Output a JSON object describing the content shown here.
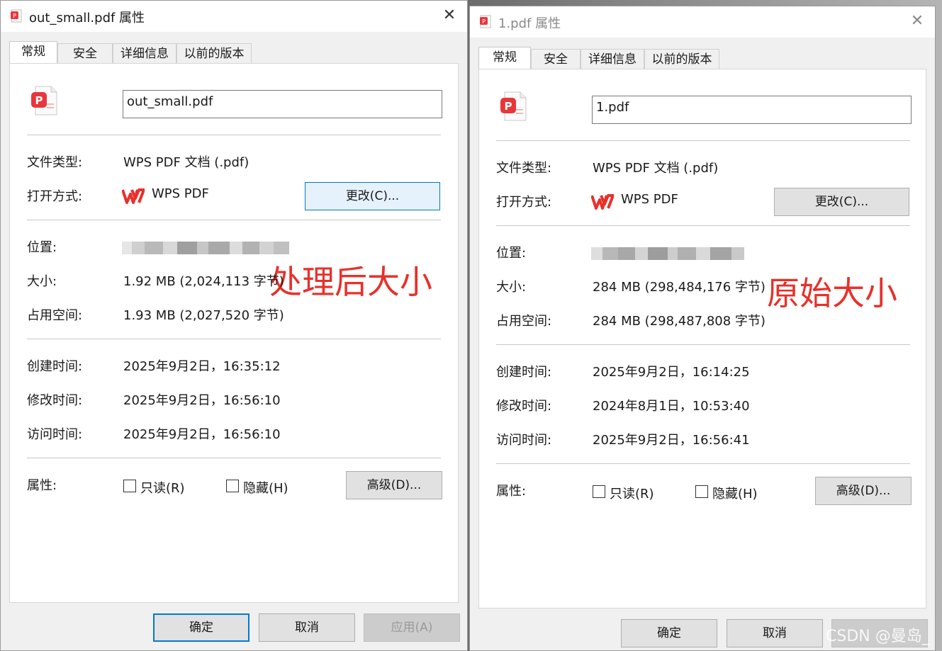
{
  "left": {
    "title": "out_small.pdf 属性",
    "tabs": [
      "常规",
      "安全",
      "详细信息",
      "以前的版本"
    ],
    "file_name": "out_small.pdf",
    "file_type_label": "文件类型:",
    "file_type": "WPS PDF 文档 (.pdf)",
    "open_with_label": "打开方式:",
    "open_with": "WPS PDF",
    "change_button": "更改(C)...",
    "location_label": "位置:",
    "size_label": "大小:",
    "size": "1.92 MB (2,024,113 字节)",
    "size_on_disk_label": "占用空间:",
    "size_on_disk": "1.93 MB (2,027,520 字节)",
    "created_label": "创建时间:",
    "created": "2025年9月2日，16:35:12",
    "modified_label": "修改时间:",
    "modified": "2025年9月2日，16:56:10",
    "accessed_label": "访问时间:",
    "accessed": "2025年9月2日，16:56:10",
    "attributes_label": "属性:",
    "readonly_label": "只读(R)",
    "hidden_label": "隐藏(H)",
    "advanced_button": "高级(D)...",
    "ok_button": "确定",
    "cancel_button": "取消",
    "apply_button": "应用(A)",
    "annotation": "处理后大小"
  },
  "right": {
    "title": "1.pdf 属性",
    "tabs": [
      "常规",
      "安全",
      "详细信息",
      "以前的版本"
    ],
    "file_name": "1.pdf",
    "file_type_label": "文件类型:",
    "file_type": "WPS PDF 文档 (.pdf)",
    "open_with_label": "打开方式:",
    "open_with": "WPS PDF",
    "change_button": "更改(C)...",
    "location_label": "位置:",
    "size_label": "大小:",
    "size": "284 MB (298,484,176 字节)",
    "size_on_disk_label": "占用空间:",
    "size_on_disk": "284 MB (298,487,808 字节)",
    "created_label": "创建时间:",
    "created": "2025年9月2日，16:14:25",
    "modified_label": "修改时间:",
    "modified": "2024年8月1日，10:53:40",
    "accessed_label": "访问时间:",
    "accessed": "2025年9月2日，16:56:41",
    "attributes_label": "属性:",
    "readonly_label": "只读(R)",
    "hidden_label": "隐藏(H)",
    "advanced_button": "高级(D)...",
    "ok_button": "确定",
    "cancel_button": "取消",
    "annotation": "原始大小"
  },
  "watermark": "CSDN @曼岛_",
  "colors": {
    "accent": "#0078d7",
    "annotation": "#e8302a",
    "pdf_red": "#e8363b",
    "wps_red": "#e8302a"
  }
}
